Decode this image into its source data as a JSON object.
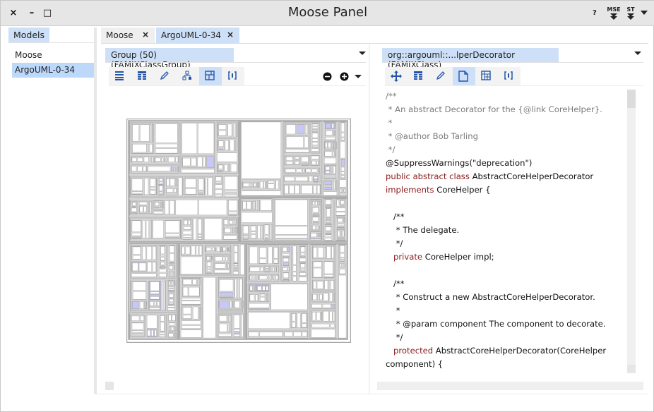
{
  "window": {
    "title": "Moose Panel",
    "close_label": "×",
    "minimize_label": "–",
    "maximize_label": "□",
    "help_label": "?",
    "mse_label": "MSE",
    "st_label": "ST"
  },
  "models": {
    "tab_label": "Models",
    "items": [
      {
        "label": "Moose",
        "selected": false
      },
      {
        "label": "ArgoUML-0-34",
        "selected": true
      }
    ]
  },
  "tabs": [
    {
      "label": "Moose",
      "close": "×"
    },
    {
      "label": "ArgoUML-0-34",
      "close": "×",
      "active": true
    }
  ],
  "left_pane": {
    "dropdown_label": "Group (50) (FAMIXClassGroup)",
    "tools": [
      "list-icon",
      "table-icon",
      "pencil-icon",
      "tree-icon",
      "treemap-icon",
      "brackets-icon"
    ],
    "active_tool": 4,
    "zoom_out_icon": "minus-circle-icon",
    "zoom_in_icon": "plus-circle-icon"
  },
  "right_pane": {
    "dropdown_label": "org::argouml::...lperDecorator (FAMIXClass)",
    "tools": [
      "move-icon",
      "table-icon",
      "pencil-icon",
      "document-icon",
      "grid-icon",
      "brackets-icon"
    ],
    "active_tool": 3,
    "code_lines": [
      [
        [
          "cm",
          "/**"
        ]
      ],
      [
        [
          "cm",
          " * An abstract Decorator for the {@link CoreHelper}."
        ]
      ],
      [
        [
          "cm",
          " *"
        ]
      ],
      [
        [
          "cm",
          " * @author Bob Tarling"
        ]
      ],
      [
        [
          "cm",
          " */"
        ]
      ],
      [
        [
          "tx",
          "@SuppressWarnings(\"deprecation\")"
        ]
      ],
      [
        [
          "kw",
          "public abstract class "
        ],
        [
          "tx",
          "AbstractCoreHelperDecorator"
        ]
      ],
      [
        [
          "kw",
          "implements "
        ],
        [
          "tx",
          "CoreHelper {"
        ]
      ],
      [
        [
          "tx",
          ""
        ]
      ],
      [
        [
          "tx",
          "   /**"
        ]
      ],
      [
        [
          "tx",
          "    * The delegate."
        ]
      ],
      [
        [
          "tx",
          "    */"
        ]
      ],
      [
        [
          "kw",
          "   private "
        ],
        [
          "tx",
          "CoreHelper impl;"
        ]
      ],
      [
        [
          "tx",
          ""
        ]
      ],
      [
        [
          "tx",
          "   /**"
        ]
      ],
      [
        [
          "tx",
          "    * Construct a new AbstractCoreHelperDecorator."
        ]
      ],
      [
        [
          "tx",
          "    *"
        ]
      ],
      [
        [
          "tx",
          "    * @param component The component to decorate."
        ]
      ],
      [
        [
          "tx",
          "    */"
        ]
      ],
      [
        [
          "kw",
          "   protected "
        ],
        [
          "tx",
          "AbstractCoreHelperDecorator(CoreHelper"
        ]
      ],
      [
        [
          "tx",
          "component) {"
        ]
      ]
    ]
  },
  "colors": {
    "selection": "#bcd8fa",
    "tab_active": "#cde0f7",
    "treemap_highlight": "#c8c8f8",
    "treemap_border": "#a9a9a9",
    "keyword": "#8a1a1a",
    "comment": "#7a7a7a"
  }
}
